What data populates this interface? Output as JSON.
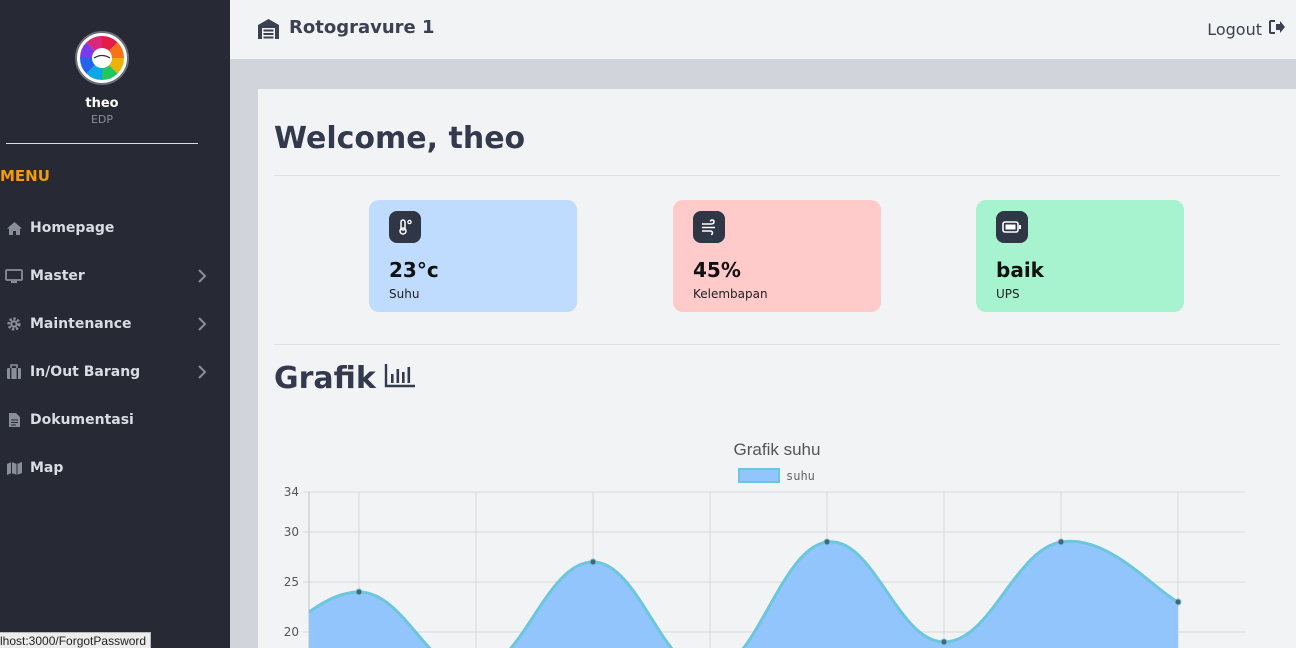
{
  "sidebar": {
    "user_name": "theo",
    "user_role": "EDP",
    "menu_heading": "MENU",
    "items": [
      {
        "label": "Homepage",
        "icon": "home-icon",
        "has_submenu": false
      },
      {
        "label": "Master",
        "icon": "monitor-icon",
        "has_submenu": true
      },
      {
        "label": "Maintenance",
        "icon": "gear-icon",
        "has_submenu": true
      },
      {
        "label": "In/Out Barang",
        "icon": "briefcase-icon",
        "has_submenu": true
      },
      {
        "label": "Dokumentasi",
        "icon": "document-icon",
        "has_submenu": false
      },
      {
        "label": "Map",
        "icon": "map-icon",
        "has_submenu": false
      }
    ]
  },
  "status_bar": {
    "url": "lhost:3000/ForgotPassword"
  },
  "topbar": {
    "title": "Rotogravure 1",
    "logout_label": "Logout"
  },
  "main": {
    "welcome": "Welcome, theo",
    "cards": [
      {
        "value": "23°c",
        "label": "Suhu",
        "icon": "thermometer-icon",
        "bg": "#bfdbfe"
      },
      {
        "value": "45%",
        "label": "Kelembapan",
        "icon": "wind-icon",
        "bg": "#fecaca"
      },
      {
        "value": "baik",
        "label": "UPS",
        "icon": "battery-icon",
        "bg": "#a7f3d0"
      }
    ],
    "grafik_title": "Grafik"
  },
  "chart_data": {
    "type": "area",
    "title": "Grafik suhu",
    "series": [
      {
        "name": "suhu",
        "values": [
          16,
          24,
          16,
          27,
          16,
          29,
          19,
          29,
          23
        ]
      }
    ],
    "x": [
      "",
      "",
      "",
      "",
      "",
      "",
      "",
      "",
      ""
    ],
    "ylim": [
      15,
      34
    ],
    "yticks": [
      20,
      25,
      30,
      34
    ],
    "grid": true,
    "legend": "top",
    "colors": {
      "fill": "#93c5fd",
      "stroke": "#6cc6dc",
      "point": "#4b6372"
    }
  }
}
